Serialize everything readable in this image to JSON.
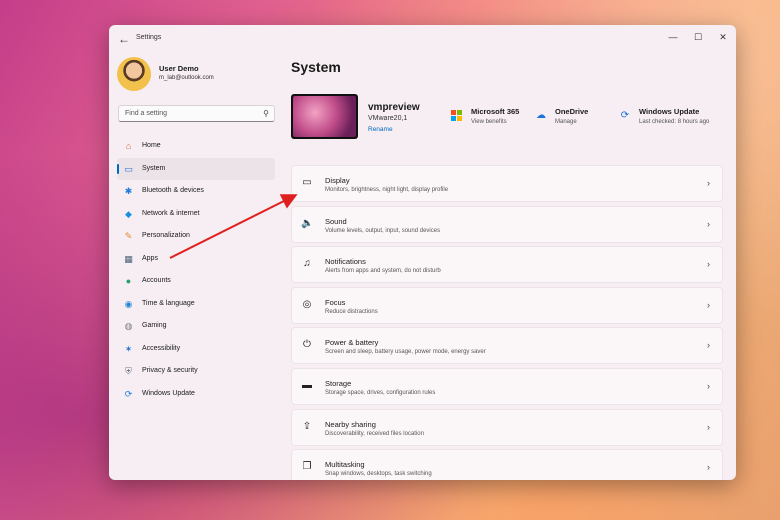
{
  "window": {
    "app_title": "Settings",
    "back": "←",
    "minimize": "—",
    "maximize": "☐",
    "close": "✕"
  },
  "profile": {
    "name": "User Demo",
    "email": "m_lab@outlook.com"
  },
  "search": {
    "placeholder": "Find a setting",
    "icon": "search-icon"
  },
  "sidebar": {
    "items": [
      {
        "label": "Home",
        "icon": "home-icon",
        "glyph": "⌂",
        "color": "#d46a3a",
        "active": false
      },
      {
        "label": "System",
        "icon": "system-icon",
        "glyph": "▭",
        "color": "#2b6fd6",
        "active": true
      },
      {
        "label": "Bluetooth & devices",
        "icon": "bluetooth-icon",
        "glyph": "✱",
        "color": "#1f7be0",
        "active": false
      },
      {
        "label": "Network & internet",
        "icon": "wifi-icon",
        "glyph": "◆",
        "color": "#1a8fe3",
        "active": false
      },
      {
        "label": "Personalization",
        "icon": "brush-icon",
        "glyph": "✎",
        "color": "#e08a32",
        "active": false
      },
      {
        "label": "Apps",
        "icon": "apps-icon",
        "glyph": "▦",
        "color": "#4a6178",
        "active": false
      },
      {
        "label": "Accounts",
        "icon": "accounts-icon",
        "glyph": "●",
        "color": "#28a06a",
        "active": false
      },
      {
        "label": "Time & language",
        "icon": "globe-icon",
        "glyph": "◉",
        "color": "#2384d6",
        "active": false
      },
      {
        "label": "Gaming",
        "icon": "gaming-icon",
        "glyph": "◍",
        "color": "#7a7f86",
        "active": false
      },
      {
        "label": "Accessibility",
        "icon": "accessibility-icon",
        "glyph": "✶",
        "color": "#1f6fd2",
        "active": false
      },
      {
        "label": "Privacy & security",
        "icon": "shield-icon",
        "glyph": "⛨",
        "color": "#6b7785",
        "active": false
      },
      {
        "label": "Windows Update",
        "icon": "update-icon",
        "glyph": "⟳",
        "color": "#1f7be0",
        "active": false
      }
    ]
  },
  "main": {
    "title": "System",
    "device": {
      "name": "vmpreview",
      "model": "VMware20,1",
      "rename": "Rename"
    },
    "quick": [
      {
        "title": "Microsoft 365",
        "sub": "View benefits",
        "icon": "microsoft-365-icon"
      },
      {
        "title": "OneDrive",
        "sub": "Manage",
        "icon": "onedrive-icon",
        "glyph": "☁",
        "color": "#1a73d9"
      },
      {
        "title": "Windows Update",
        "sub": "Last checked: 8 hours ago",
        "icon": "windows-update-icon",
        "glyph": "⟳",
        "color": "#1a73d9"
      }
    ],
    "cards": [
      {
        "title": "Display",
        "sub": "Monitors, brightness, night light, display profile",
        "icon": "display-icon",
        "glyph": "▭"
      },
      {
        "title": "Sound",
        "sub": "Volume levels, output, input, sound devices",
        "icon": "speaker-icon",
        "glyph": "🔈"
      },
      {
        "title": "Notifications",
        "sub": "Alerts from apps and system, do not disturb",
        "icon": "bell-icon",
        "glyph": "♫"
      },
      {
        "title": "Focus",
        "sub": "Reduce distractions",
        "icon": "focus-icon",
        "glyph": "◎"
      },
      {
        "title": "Power & battery",
        "sub": "Screen and sleep, battery usage, power mode, energy saver",
        "icon": "power-icon",
        "glyph": "⏻"
      },
      {
        "title": "Storage",
        "sub": "Storage space, drives, configuration rules",
        "icon": "storage-icon",
        "glyph": "▬"
      },
      {
        "title": "Nearby sharing",
        "sub": "Discoverability, received files location",
        "icon": "share-icon",
        "glyph": "⇪"
      },
      {
        "title": "Multitasking",
        "sub": "Snap windows, desktops, task switching",
        "icon": "multitasking-icon",
        "glyph": "❐"
      }
    ],
    "chevron": "›"
  },
  "annotation": {
    "arrow_color": "#e02020"
  }
}
